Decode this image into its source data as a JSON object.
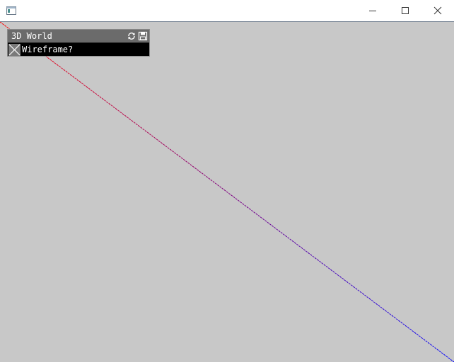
{
  "window": {
    "title": "",
    "controls": {
      "minimize_icon": "minimize-icon",
      "maximize_icon": "maximize-icon",
      "close_icon": "close-icon"
    }
  },
  "scene": {
    "background_color": "#c8c8c8",
    "line_start_color": "#ff0000",
    "line_end_color": "#0000ff"
  },
  "gui": {
    "panel_title": "3D World",
    "header_icons": [
      "reload-icon",
      "save-icon"
    ],
    "toggle": {
      "label": "Wireframe?",
      "checked": true
    }
  }
}
